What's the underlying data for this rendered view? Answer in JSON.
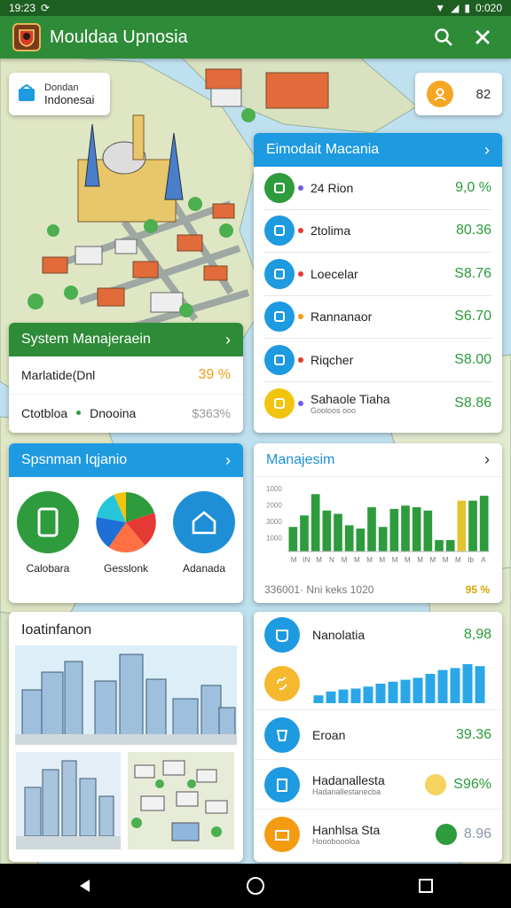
{
  "status_bar": {
    "time": "19:23",
    "sync_icon": "sync-icon",
    "right_text": "0:020"
  },
  "app_bar": {
    "title": "Mouldaa Upnosia",
    "logo": "crest-logo-icon",
    "search_icon": "search-icon",
    "close_icon": "close-icon"
  },
  "location_chip": {
    "line1": "Dondan",
    "line2": "Indonesai"
  },
  "user_chip": {
    "label": "82"
  },
  "list_card": {
    "title": "Eimodait Macania",
    "items": [
      {
        "label": "24 Rion",
        "value": "9,0 %",
        "icon": "gift-icon",
        "icon_color": "#2e9b3c",
        "dot_color": "#6c5ce7"
      },
      {
        "label": "2tolima",
        "value": "80.36",
        "icon": "box-icon",
        "icon_color": "#1e9ae0",
        "dot_color": "#e53935"
      },
      {
        "label": "Loecelar",
        "value": "S8.76",
        "icon": "tablet-icon",
        "icon_color": "#1e9ae0",
        "dot_color": "#e53935"
      },
      {
        "label": "Rannanaor",
        "value": "S6.70",
        "icon": "chart-icon",
        "icon_color": "#1e9ae0",
        "dot_color": "#f39c12"
      },
      {
        "label": "Riqcher",
        "value": "S8.00",
        "icon": "document-icon",
        "icon_color": "#1e9ae0",
        "dot_color": "#e53935"
      },
      {
        "label": "Sahaole Tiaha",
        "sub": "Gooloos ooo",
        "value": "S8.86",
        "icon": "mascot-icon",
        "icon_color": "#f1c40f",
        "dot_color": "#6c5ce7"
      }
    ]
  },
  "system_card": {
    "title": "System Manajeraein",
    "row1": {
      "label": "Marlatide(Dnl",
      "value": "39 %"
    },
    "row2": {
      "label": "Ctotbloa",
      "label2": "Dnooina",
      "value": "$363%"
    }
  },
  "icons_card": {
    "title": "Spsnman Iqjanio",
    "items": [
      {
        "label": "Calobara",
        "icon": "phone-icon",
        "color": "#2e9b3c"
      },
      {
        "label": "Gesslonk",
        "icon": "pie-chart-icon",
        "color": "#ffffff"
      },
      {
        "label": "Adanada",
        "icon": "house-icon",
        "color": "#1e8fd6"
      }
    ]
  },
  "chart_card": {
    "title": "Manajesim",
    "footer_left": "336001· Nni keks 1020",
    "footer_pct": "95 %"
  },
  "chart_data": {
    "type": "bar",
    "yticks": [
      "1000",
      "2000",
      "3000",
      "1000"
    ],
    "xticks": [
      "M",
      "N",
      "M",
      "M",
      "M",
      "M",
      "M",
      "M",
      "M",
      "M",
      "M",
      "M",
      "M",
      "M",
      "M",
      "M",
      "M",
      "M",
      "M",
      "M",
      "M",
      "M",
      "M",
      "M"
    ],
    "x_tick_labels": [
      "M",
      "IN",
      "M",
      "N",
      "M",
      "M",
      "M",
      "M",
      "M",
      "M",
      "M",
      "M",
      "M",
      "M",
      "M",
      "M",
      "M",
      "M",
      "M",
      "M",
      "M",
      "M",
      "M",
      "M"
    ],
    "values": [
      1500,
      2200,
      3500,
      2500,
      2300,
      1600,
      1400,
      2700,
      1500,
      2600,
      2800,
      2700,
      2500,
      700,
      700,
      3100,
      3100,
      3400
    ],
    "colors": [
      "#2e9b3c",
      "#2e9b3c",
      "#2e9b3c",
      "#2e9b3c",
      "#2e9b3c",
      "#2e9b3c",
      "#2e9b3c",
      "#2e9b3c",
      "#2e9b3c",
      "#2e9b3c",
      "#2e9b3c",
      "#2e9b3c",
      "#2e9b3c",
      "#2e9b3c",
      "#2e9b3c",
      "#e3c32f",
      "#2e9b3c",
      "#2e9b3c"
    ],
    "bottom_labels": [
      "M",
      "IN",
      "M",
      "N",
      "M",
      "M",
      "M",
      "M",
      "M",
      "M",
      "M",
      "M",
      "M",
      "M",
      "Ib",
      "A"
    ],
    "ylim": [
      0,
      4000
    ]
  },
  "build_card": {
    "title": "Ioatinfanon"
  },
  "stats_card": {
    "header": {
      "label": "Nanolatia",
      "value": "8,98"
    },
    "mini_bars": [
      8,
      12,
      14,
      15,
      17,
      20,
      22,
      24,
      26,
      30,
      34,
      36,
      40,
      38
    ],
    "rows": [
      {
        "label": "Eroan",
        "value": "39.36",
        "icon": "cup-icon",
        "color": "#1e9ae0"
      },
      {
        "label": "Hadanallesta",
        "sub": "Hadanallestanecba",
        "value": "S96%",
        "icon": "building-icon",
        "color": "#1e9ae0",
        "dot": "#f4d35e"
      },
      {
        "label": "Hanhlsa Sta",
        "sub": "Hoooboooloa",
        "value": "8.96",
        "icon": "folder-icon",
        "color": "#f39c12",
        "dot": "#2e9b3c"
      }
    ]
  },
  "nav": {
    "back_icon": "back-icon",
    "home_icon": "home-icon",
    "recents_icon": "recents-icon"
  }
}
